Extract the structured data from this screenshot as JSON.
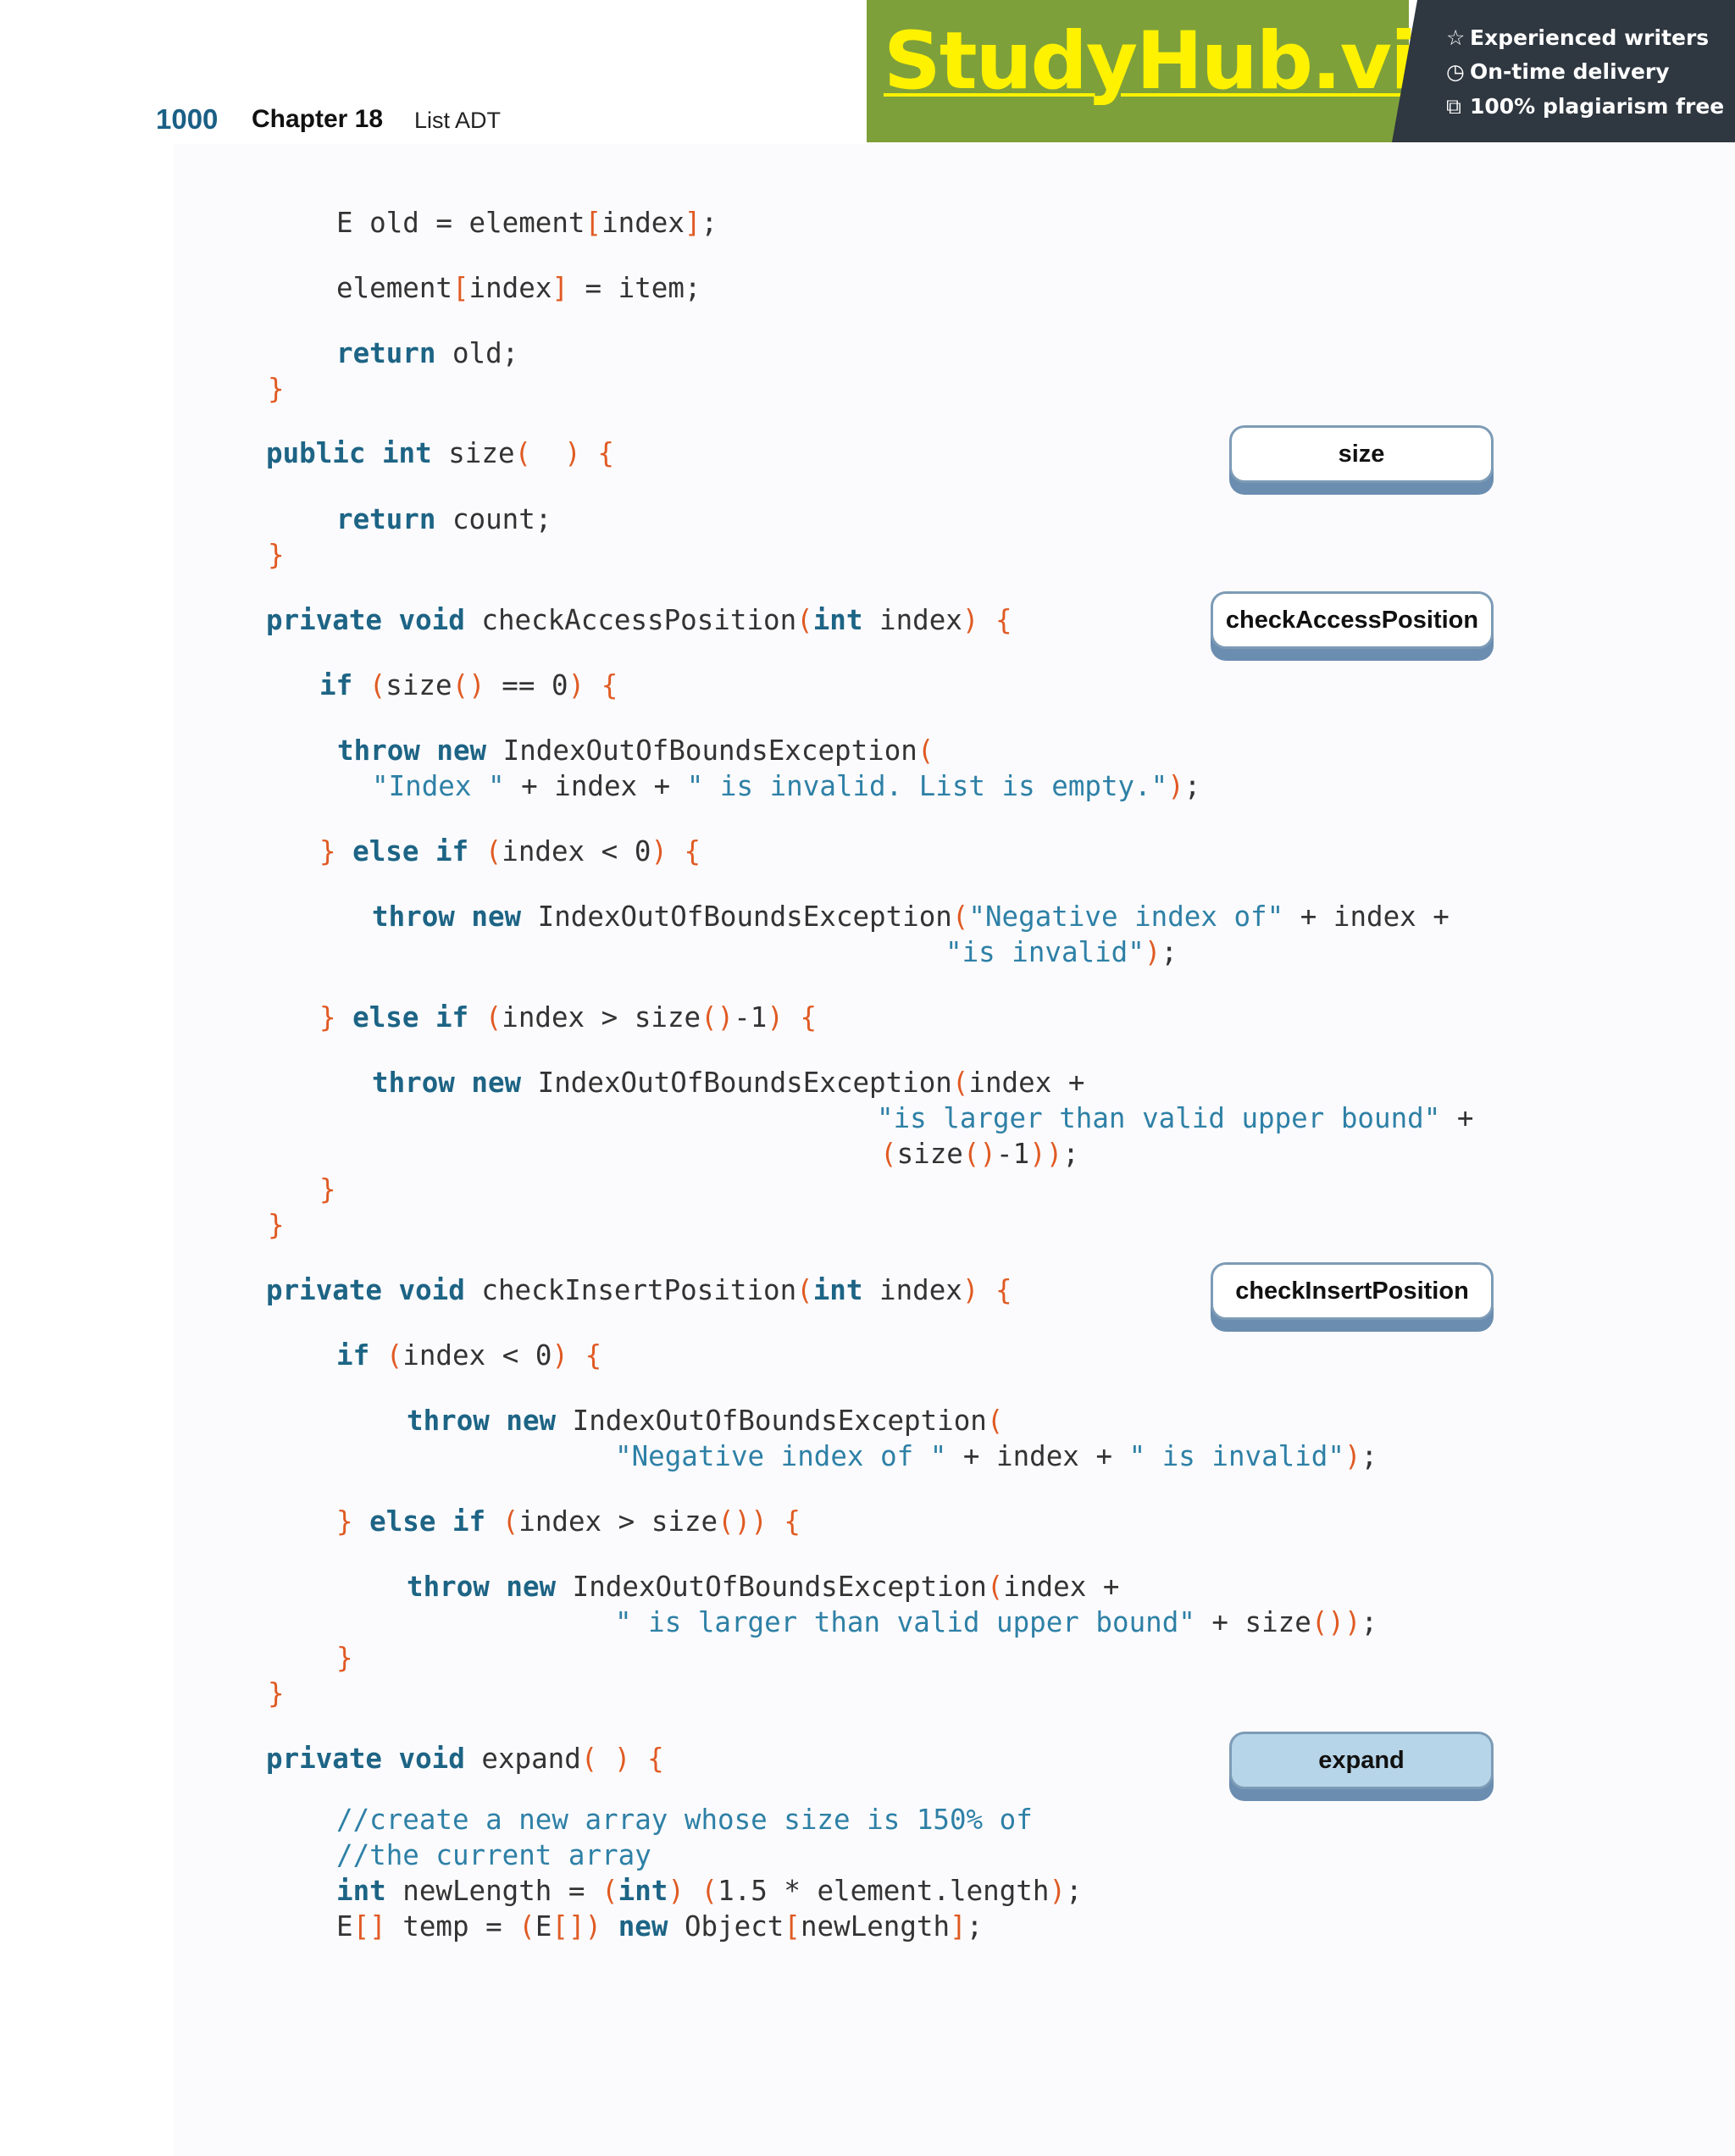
{
  "header": {
    "page_number": "1000",
    "chapter": "Chapter 18",
    "chapter_title": "List ADT"
  },
  "banner": {
    "logo": "StudyHub.vip",
    "features": [
      {
        "icon": "star-icon",
        "glyph": "☆",
        "text": "Experienced writers"
      },
      {
        "icon": "clock-icon",
        "glyph": "◷",
        "text": "On-time delivery"
      },
      {
        "icon": "copy-icon",
        "glyph": "⧉",
        "text": "100% plagiarism free"
      }
    ],
    "colors": {
      "green": "#7ea03a",
      "dark": "#2f3740",
      "logo": "#fff200"
    }
  },
  "side_labels": [
    "size",
    "checkAccessPosition",
    "checkInsertPosition",
    "expand"
  ],
  "code_lines": [
    [
      [
        "t",
        "E old = element"
      ],
      [
        "p",
        "["
      ],
      [
        "t",
        "index"
      ],
      [
        "p",
        "]"
      ],
      [
        "t",
        ";"
      ]
    ],
    [
      [
        "t",
        "element"
      ],
      [
        "p",
        "["
      ],
      [
        "t",
        "index"
      ],
      [
        "p",
        "]"
      ],
      [
        "t",
        " = item;"
      ]
    ],
    [
      [
        "k",
        "return"
      ],
      [
        "t",
        " old;"
      ]
    ],
    [
      [
        "p",
        "}"
      ]
    ],
    [
      [
        "k",
        "public int"
      ],
      [
        "t",
        " size"
      ],
      [
        "p",
        "(  )"
      ],
      [
        "t",
        " "
      ],
      [
        "p",
        "{"
      ]
    ],
    [
      [
        "k",
        "return"
      ],
      [
        "t",
        " count;"
      ]
    ],
    [
      [
        "p",
        "}"
      ]
    ],
    [
      [
        "k",
        "private void"
      ],
      [
        "t",
        " checkAccessPosition"
      ],
      [
        "p",
        "("
      ],
      [
        "k",
        "int"
      ],
      [
        "t",
        " index"
      ],
      [
        "p",
        ")"
      ],
      [
        "t",
        " "
      ],
      [
        "p",
        "{"
      ]
    ],
    [
      [
        "k",
        "if"
      ],
      [
        "t",
        " "
      ],
      [
        "p",
        "("
      ],
      [
        "t",
        "size"
      ],
      [
        "p",
        "()"
      ],
      [
        "t",
        " == 0"
      ],
      [
        "p",
        ")"
      ],
      [
        "t",
        " "
      ],
      [
        "p",
        "{"
      ]
    ],
    [
      [
        "k",
        "throw new"
      ],
      [
        "t",
        " IndexOutOfBoundsException"
      ],
      [
        "p",
        "("
      ]
    ],
    [
      [
        "s",
        "\"Index \""
      ],
      [
        "t",
        " + index + "
      ],
      [
        "s",
        "\" is invalid. List is empty.\""
      ],
      [
        "p",
        ")"
      ],
      [
        "t",
        ";"
      ]
    ],
    [
      [
        "p",
        "}"
      ],
      [
        "t",
        " "
      ],
      [
        "k",
        "else if"
      ],
      [
        "t",
        " "
      ],
      [
        "p",
        "("
      ],
      [
        "t",
        "index < 0"
      ],
      [
        "p",
        ")"
      ],
      [
        "t",
        " "
      ],
      [
        "p",
        "{"
      ]
    ],
    [
      [
        "k",
        "throw new"
      ],
      [
        "t",
        " IndexOutOfBoundsException"
      ],
      [
        "p",
        "("
      ],
      [
        "s",
        "\"Negative index of\""
      ],
      [
        "t",
        " + index +"
      ]
    ],
    [
      [
        "s",
        "\"is invalid\""
      ],
      [
        "p",
        ")"
      ],
      [
        "t",
        ";"
      ]
    ],
    [
      [
        "p",
        "}"
      ],
      [
        "t",
        " "
      ],
      [
        "k",
        "else if"
      ],
      [
        "t",
        " "
      ],
      [
        "p",
        "("
      ],
      [
        "t",
        "index > size"
      ],
      [
        "p",
        "()"
      ],
      [
        "t",
        "-1"
      ],
      [
        "p",
        ")"
      ],
      [
        "t",
        " "
      ],
      [
        "p",
        "{"
      ]
    ],
    [
      [
        "k",
        "throw new"
      ],
      [
        "t",
        " IndexOutOfBoundsException"
      ],
      [
        "p",
        "("
      ],
      [
        "t",
        "index +"
      ]
    ],
    [
      [
        "s",
        "\"is larger than valid upper bound\""
      ],
      [
        "t",
        " +"
      ]
    ],
    [
      [
        "p",
        "("
      ],
      [
        "t",
        "size"
      ],
      [
        "p",
        "()"
      ],
      [
        "t",
        "-1"
      ],
      [
        "p",
        "))"
      ],
      [
        "t",
        ";"
      ]
    ],
    [
      [
        "p",
        "}"
      ]
    ],
    [
      [
        "p",
        "}"
      ]
    ],
    [
      [
        "k",
        "private void"
      ],
      [
        "t",
        " checkInsertPosition"
      ],
      [
        "p",
        "("
      ],
      [
        "k",
        "int"
      ],
      [
        "t",
        " index"
      ],
      [
        "p",
        ")"
      ],
      [
        "t",
        " "
      ],
      [
        "p",
        "{"
      ]
    ],
    [
      [
        "k",
        "if"
      ],
      [
        "t",
        " "
      ],
      [
        "p",
        "("
      ],
      [
        "t",
        "index < 0"
      ],
      [
        "p",
        ")"
      ],
      [
        "t",
        " "
      ],
      [
        "p",
        "{"
      ]
    ],
    [
      [
        "k",
        "throw new"
      ],
      [
        "t",
        " IndexOutOfBoundsException"
      ],
      [
        "p",
        "("
      ]
    ],
    [
      [
        "s",
        "\"Negative index of \""
      ],
      [
        "t",
        " + index + "
      ],
      [
        "s",
        "\" is invalid\""
      ],
      [
        "p",
        ")"
      ],
      [
        "t",
        ";"
      ]
    ],
    [
      [
        "p",
        "}"
      ],
      [
        "t",
        " "
      ],
      [
        "k",
        "else if"
      ],
      [
        "t",
        " "
      ],
      [
        "p",
        "("
      ],
      [
        "t",
        "index > size"
      ],
      [
        "p",
        "())"
      ],
      [
        "t",
        " "
      ],
      [
        "p",
        "{"
      ]
    ],
    [
      [
        "k",
        "throw new"
      ],
      [
        "t",
        " IndexOutOfBoundsException"
      ],
      [
        "p",
        "("
      ],
      [
        "t",
        "index +"
      ]
    ],
    [
      [
        "s",
        "\" is larger than valid upper bound\""
      ],
      [
        "t",
        " + size"
      ],
      [
        "p",
        "())"
      ],
      [
        "t",
        ";"
      ]
    ],
    [
      [
        "p",
        "}"
      ]
    ],
    [
      [
        "p",
        "}"
      ]
    ],
    [
      [
        "k",
        "private void"
      ],
      [
        "t",
        " expand"
      ],
      [
        "p",
        "( )"
      ],
      [
        "t",
        " "
      ],
      [
        "p",
        "{"
      ]
    ],
    [
      [
        "c",
        "//create a new array whose size is 150% of"
      ]
    ],
    [
      [
        "c",
        "//the current array"
      ]
    ],
    [
      [
        "k",
        "int"
      ],
      [
        "t",
        " newLength = "
      ],
      [
        "p",
        "("
      ],
      [
        "k",
        "int"
      ],
      [
        "p",
        ")"
      ],
      [
        "t",
        " "
      ],
      [
        "p",
        "("
      ],
      [
        "t",
        "1.5 * element.length"
      ],
      [
        "p",
        ")"
      ],
      [
        "t",
        ";"
      ]
    ],
    [
      [
        "t",
        "E"
      ],
      [
        "p",
        "[]"
      ],
      [
        "t",
        " temp = "
      ],
      [
        "p",
        "("
      ],
      [
        "t",
        "E"
      ],
      [
        "p",
        "[])"
      ],
      [
        "t",
        " "
      ],
      [
        "k",
        "new"
      ],
      [
        "t",
        " Object"
      ],
      [
        "p",
        "["
      ],
      [
        "t",
        "newLength"
      ],
      [
        "p",
        "]"
      ],
      [
        "t",
        ";"
      ]
    ]
  ]
}
